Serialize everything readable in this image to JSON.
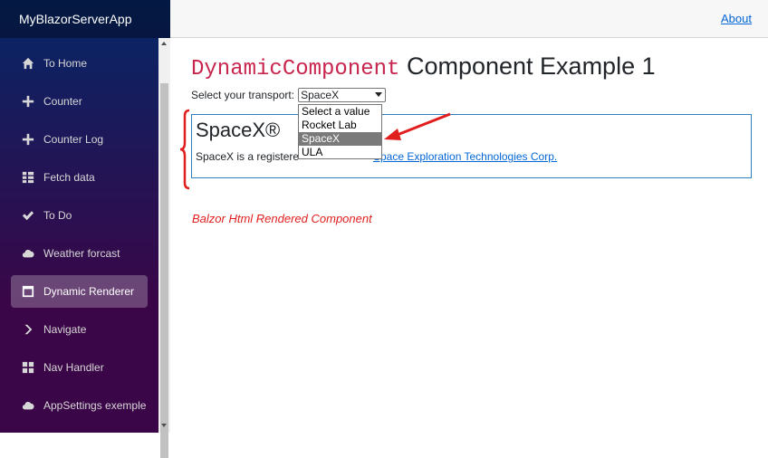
{
  "app": {
    "brand": "MyBlazorServerApp"
  },
  "sidebar": {
    "items": [
      {
        "label": "To Home",
        "icon": "home-icon"
      },
      {
        "label": "Counter",
        "icon": "plus-icon"
      },
      {
        "label": "Counter Log",
        "icon": "plus-icon"
      },
      {
        "label": "Fetch data",
        "icon": "list-icon"
      },
      {
        "label": "To Do",
        "icon": "check-icon"
      },
      {
        "label": "Weather forcast",
        "icon": "cloud-icon"
      },
      {
        "label": "Dynamic Renderer",
        "icon": "window-icon",
        "active": true
      },
      {
        "label": "Navigate",
        "icon": "chevron-right-icon"
      },
      {
        "label": "Nav Handler",
        "icon": "grid-icon"
      },
      {
        "label": "AppSettings exemple",
        "icon": "cloud-icon"
      }
    ]
  },
  "topbar": {
    "about_label": "About"
  },
  "main": {
    "title_code": "DynamicComponent",
    "title_rest": "Component Example 1",
    "select_label": "Select your transport:",
    "select_value": "SpaceX",
    "dropdown_options": [
      "Select a value",
      "Rocket Lab",
      "SpaceX",
      "ULA"
    ],
    "dropdown_selected": "SpaceX",
    "component": {
      "title": "SpaceX®",
      "text": "SpaceX is a registere",
      "link": "Space Exploration Technologies Corp."
    }
  },
  "annotation": {
    "label": "Balzor Html Rendered Component",
    "color": "#e01e1e"
  },
  "colors": {
    "sidebar_top": "#052767",
    "sidebar_bottom": "#3a0647",
    "link": "#0366d6",
    "code": "#c7254e"
  }
}
